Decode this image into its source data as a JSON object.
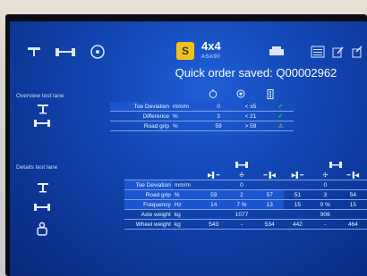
{
  "header": {
    "title": "Quick order saved: Q00002962",
    "brand_main": "4x4",
    "brand_sub": "ASA90"
  },
  "overview": {
    "label": "Overview test lane",
    "rows": [
      {
        "name": "Toe Deviation",
        "unit": "mm/m",
        "value": "0",
        "limit": "< ±5",
        "status": "ok"
      },
      {
        "name": "Difference",
        "unit": "%",
        "value": "3",
        "limit": "< 21",
        "status": "ok"
      },
      {
        "name": "Road grip",
        "unit": "%",
        "value": "59",
        "limit": "> 59",
        "status": "warn"
      }
    ]
  },
  "details": {
    "label": "Details test lane",
    "rows": [
      {
        "name": "Toe Deviation",
        "unit": "mm/m",
        "values": [
          "",
          "0",
          "",
          "",
          "0",
          ""
        ]
      },
      {
        "name": "Road grip",
        "unit": "%",
        "values": [
          "59",
          "2",
          "57",
          "51",
          "3",
          "54"
        ]
      },
      {
        "name": "Frequency",
        "unit": "Hz",
        "values": [
          "14",
          "7 %",
          "13",
          "15",
          "0 %",
          "15"
        ]
      },
      {
        "name": "Axle weight",
        "unit": "kg",
        "values": [
          "",
          "1077",
          "",
          "",
          "906",
          ""
        ]
      },
      {
        "name": "Wheel weight",
        "unit": "kg",
        "values": [
          "543",
          "-",
          "534",
          "442",
          "-",
          "464"
        ]
      }
    ]
  }
}
